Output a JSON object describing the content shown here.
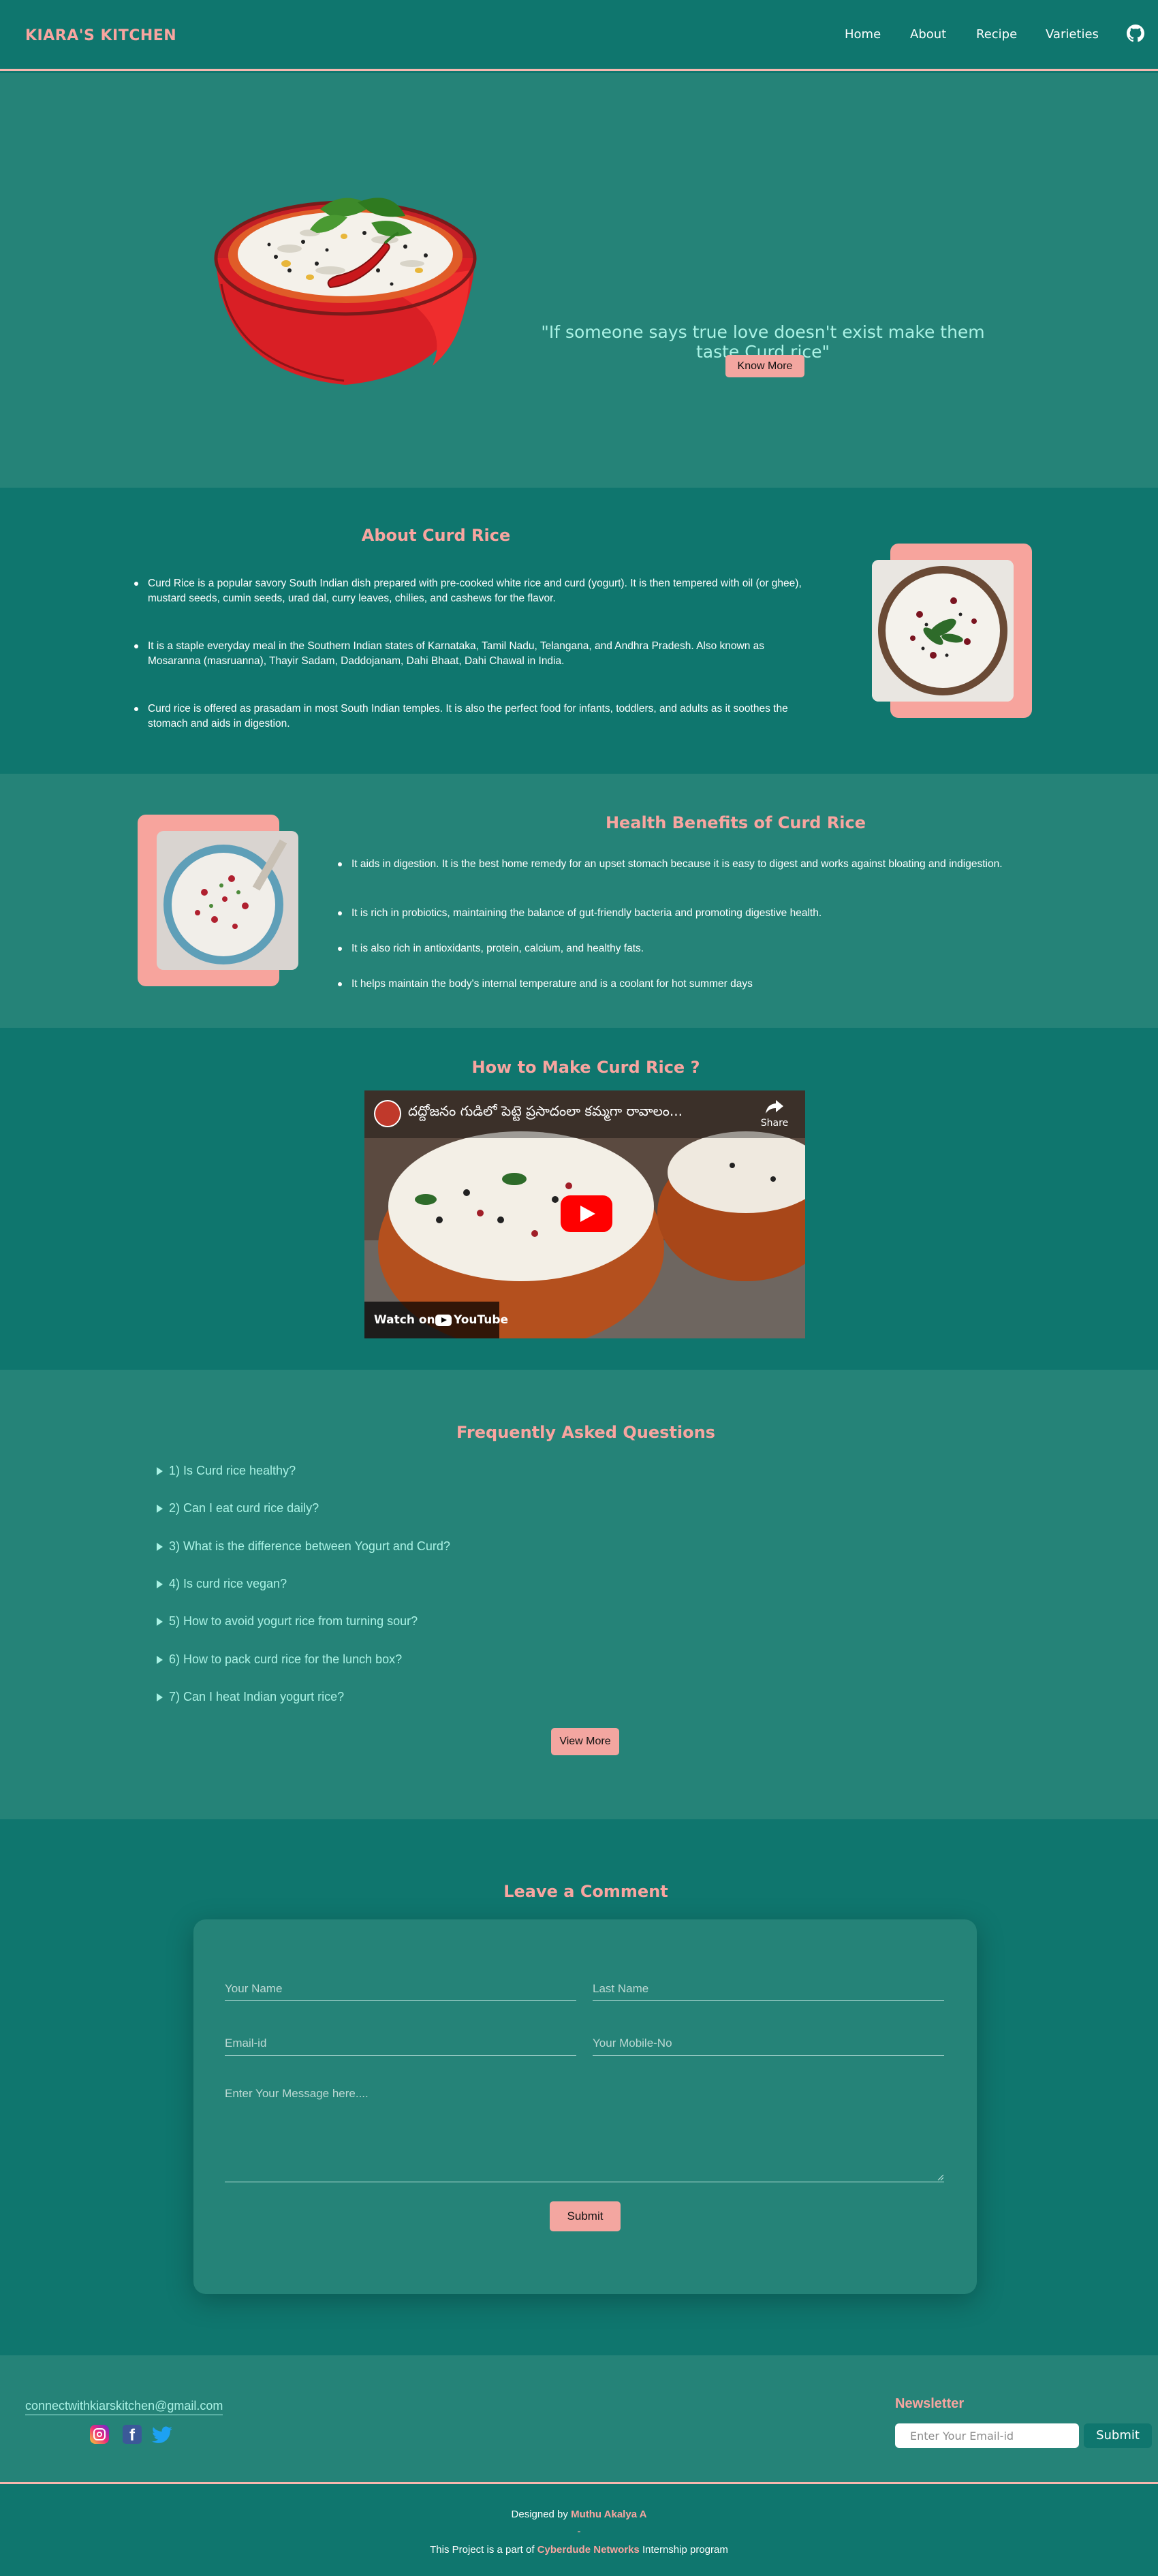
{
  "nav": {
    "brand": "KIARA'S KITCHEN",
    "links": [
      "Home",
      "About",
      "Recipe",
      "Varieties"
    ],
    "github_icon": "github-icon"
  },
  "hero": {
    "quote": "\"If someone says true love doesn't exist make them taste Curd rice\"",
    "button": "Know More"
  },
  "about": {
    "title": "About Curd Rice",
    "points": [
      "Curd Rice is a popular savory South Indian dish prepared with pre-cooked white rice and curd (yogurt). It is then tempered with oil (or ghee), mustard seeds, cumin seeds, urad dal, curry leaves, chilies, and cashews for the flavor.",
      "It is a staple everyday meal in the Southern Indian states of Karnataka, Tamil Nadu, Telangana, and Andhra Pradesh. Also known as Mosaranna (masruanna), Thayir Sadam, Daddojanam, Dahi Bhaat, Dahi Chawal in India.",
      "Curd rice is offered as prasadam in most South Indian temples. It is also the perfect food for infants, toddlers, and adults as it soothes the stomach and aids in digestion."
    ]
  },
  "health": {
    "title": "Health Benefits of Curd Rice",
    "points": [
      "It aids in digestion. It is the best home remedy for an upset stomach because it is easy to digest and works against bloating and indigestion.",
      "It is rich in probiotics, maintaining the balance of gut-friendly bacteria and promoting digestive health.",
      "It is also rich in antioxidants, protein, calcium, and healthy fats.",
      "It helps maintain the body's internal temperature and is a coolant for hot summer days"
    ]
  },
  "video": {
    "title": "How to Make Curd Rice ?",
    "video_title": "దద్దోజనం గుడిలో పెట్టె ప్రసాదంలా కమ్మగా రావాలం...",
    "share": "Share",
    "watch_on": "Watch on",
    "youtube": "YouTube"
  },
  "faq": {
    "title": "Frequently Asked Questions",
    "items": [
      "1) Is Curd rice healthy?",
      "2) Can I eat curd rice daily?",
      "3) What is the difference between Yogurt and Curd?",
      "4) Is curd rice vegan?",
      "5) How to avoid yogurt rice from turning sour?",
      "6) How to pack curd rice for the lunch box?",
      "7) Can I heat Indian yogurt rice?"
    ],
    "button": "View More"
  },
  "comment": {
    "title": "Leave a Comment",
    "first_name_placeholder": "Your Name",
    "last_name_placeholder": "Last Name",
    "email_placeholder": "Email-id",
    "mobile_placeholder": "Your Mobile-No",
    "message_placeholder": "Enter Your Message here....",
    "submit": "Submit"
  },
  "footer": {
    "email": "connectwithkiarskitchen@gmail.com",
    "newsletter_title": "Newsletter",
    "newsletter_placeholder": "Enter Your Email-id",
    "newsletter_submit": "Submit",
    "designed_by_prefix": "Designed by",
    "designer": "Muthu Akalya A",
    "separator": "-",
    "project_prefix": "This Project is a part of",
    "org": "Cyberdude Networks",
    "project_suffix": "Internship program"
  },
  "colors": {
    "primary": "#0f766e",
    "section_alt": "#258378",
    "accent": "#f8a5a0",
    "mint": "#aaf2e5"
  }
}
